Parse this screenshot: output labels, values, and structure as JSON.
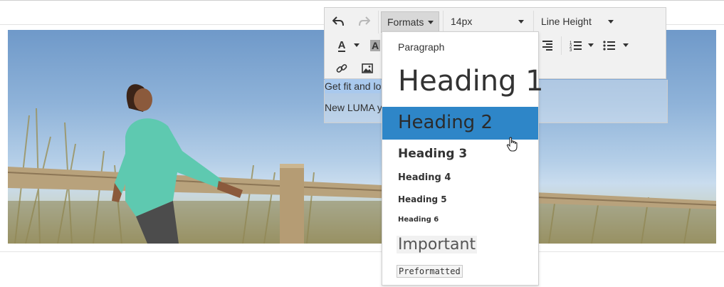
{
  "toolbar": {
    "undo_icon": "undo-icon",
    "redo_icon": "redo-icon",
    "formats_label": "Formats",
    "font_size_value": "14px",
    "line_height_label": "Line Height",
    "text_color_glyph": "A",
    "bg_color_glyph": "A"
  },
  "editor": {
    "line1_selected": "Get fit and lo",
    "line2": "New LUMA y"
  },
  "formats_menu": {
    "items": [
      {
        "label": "Paragraph"
      },
      {
        "label": "Heading 1"
      },
      {
        "label": "Heading 2",
        "state": "active"
      },
      {
        "label": "Heading 3"
      },
      {
        "label": "Heading 4"
      },
      {
        "label": "Heading 5"
      },
      {
        "label": "Heading 6"
      },
      {
        "label": "Important"
      },
      {
        "label": "Preformatted"
      }
    ]
  },
  "colors": {
    "menu_active": "#2e86c8",
    "selection": "#a9c9ee",
    "toolbar_bg": "#f1f1f1"
  }
}
